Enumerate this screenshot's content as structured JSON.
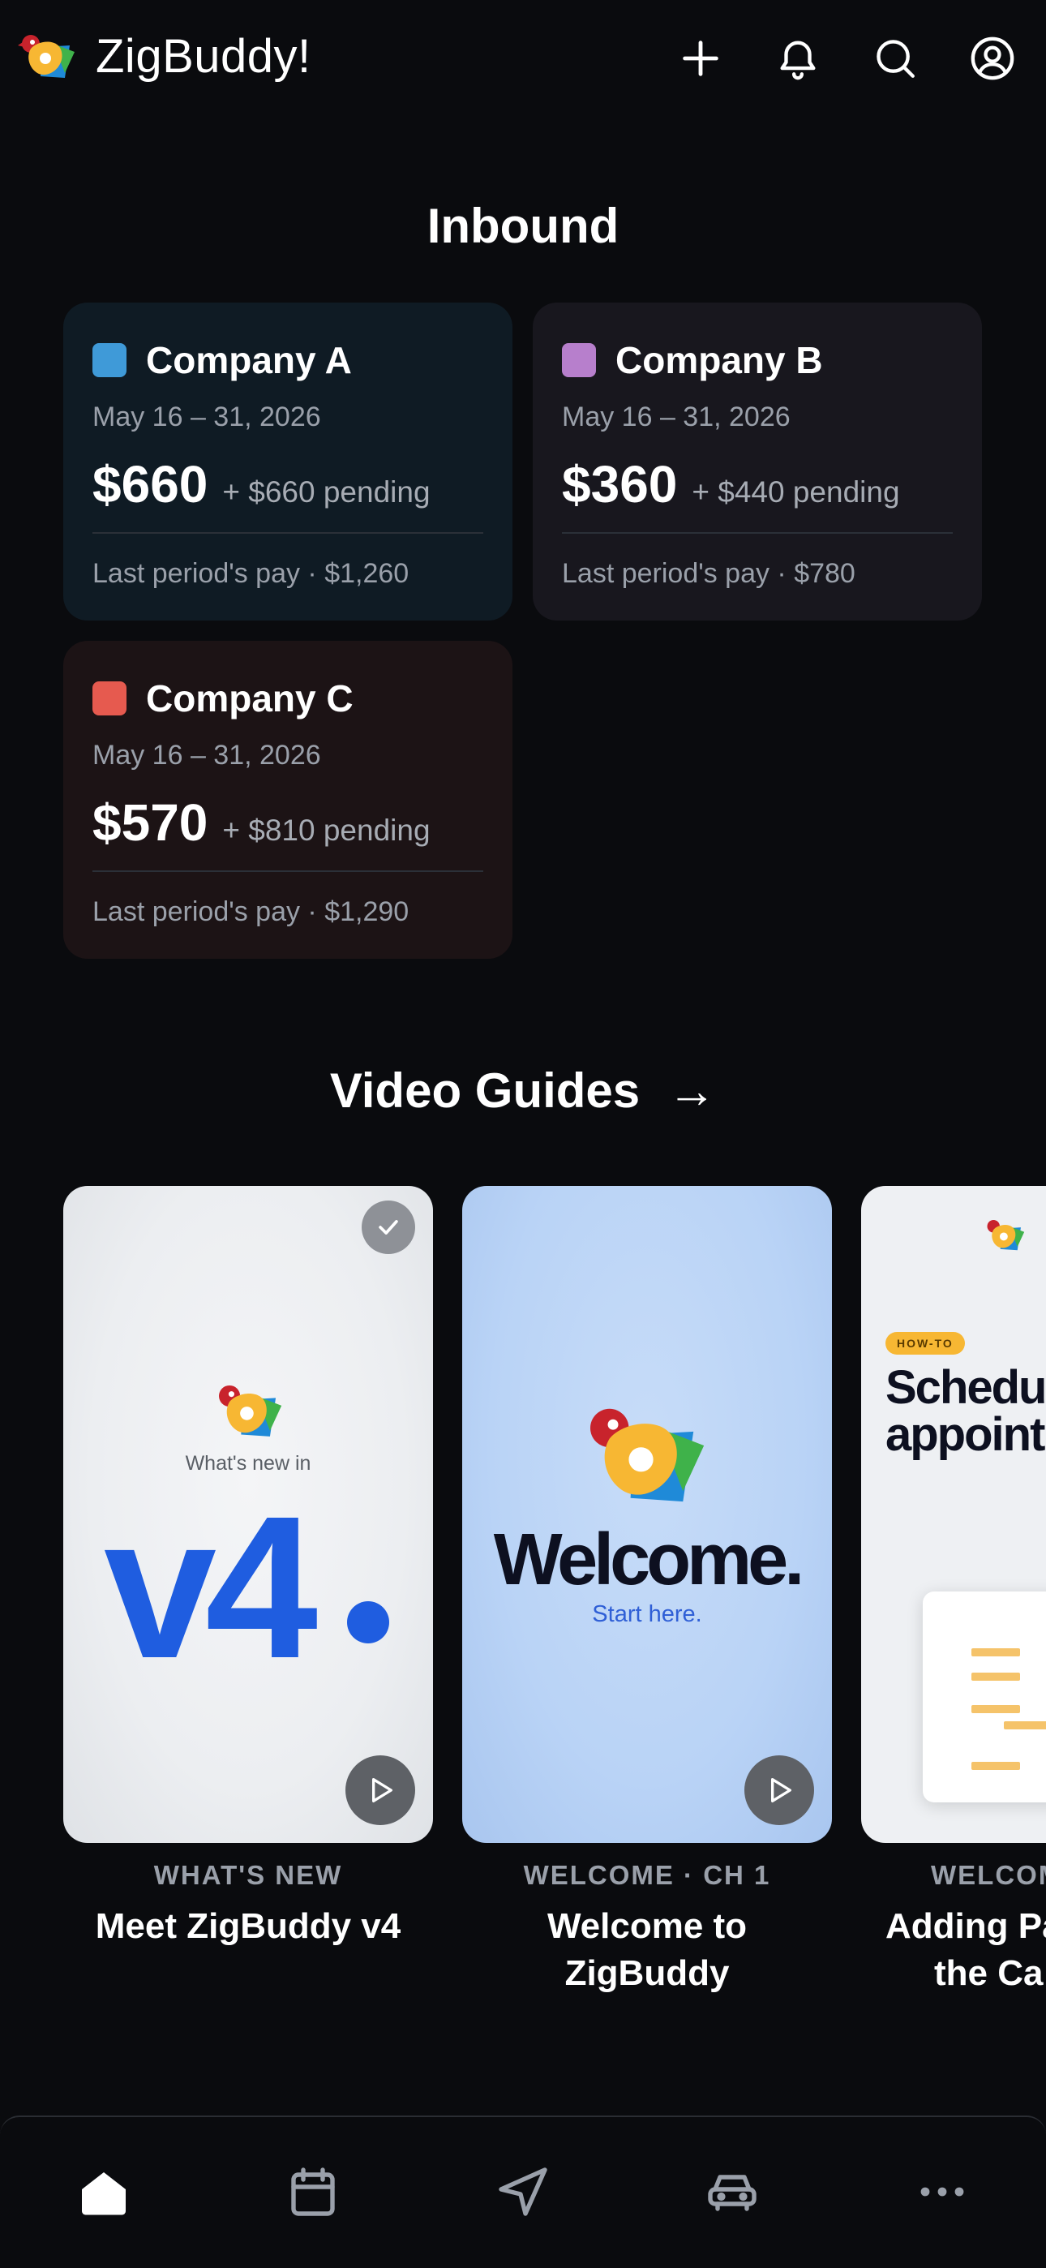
{
  "app": {
    "name": "ZigBuddy!"
  },
  "header": {
    "icons": [
      "plus-icon",
      "bell-icon",
      "search-icon",
      "account-icon"
    ]
  },
  "inbound": {
    "title": "Inbound",
    "cards": [
      {
        "company": "Company A",
        "color": "#3f9ad8",
        "dates": "May 16 – 31, 2026",
        "amount": "$660",
        "pending": "+ $660 pending",
        "last_period": "Last period's pay · $1,260"
      },
      {
        "company": "Company B",
        "color": "#b77fcc",
        "dates": "May 16 – 31, 2026",
        "amount": "$360",
        "pending": "+ $440 pending",
        "last_period": "Last period's pay · $780"
      },
      {
        "company": "Company C",
        "color": "#e65a4f",
        "dates": "May 16 – 31, 2026",
        "amount": "$570",
        "pending": "+ $810 pending",
        "last_period": "Last period's pay · $1,290"
      }
    ]
  },
  "video_guides": {
    "title": "Video Guides",
    "arrow": "→",
    "videos": [
      {
        "thumb_small": "What's new in",
        "thumb_big": "v4",
        "category": "WHAT'S NEW",
        "title_line1": "Meet ZigBuddy v4",
        "title_line2": "",
        "watched": true
      },
      {
        "thumb_big": "Welcome.",
        "thumb_small": "Start here.",
        "category": "WELCOME · CH 1",
        "title_line1": "Welcome to",
        "title_line2": "ZigBuddy",
        "watched": false
      },
      {
        "badge": "HOW-TO",
        "thumb_title_line1": "Schedu",
        "thumb_title_line2": "appoint",
        "category": "WELCOM",
        "title_line1": "Adding Pa",
        "title_line2": "the Ca",
        "watched": false
      }
    ]
  },
  "bottom_nav": {
    "items": [
      "home-icon",
      "calendar-icon",
      "navigation-icon",
      "car-icon",
      "more-icon"
    ],
    "active": "home-icon"
  }
}
